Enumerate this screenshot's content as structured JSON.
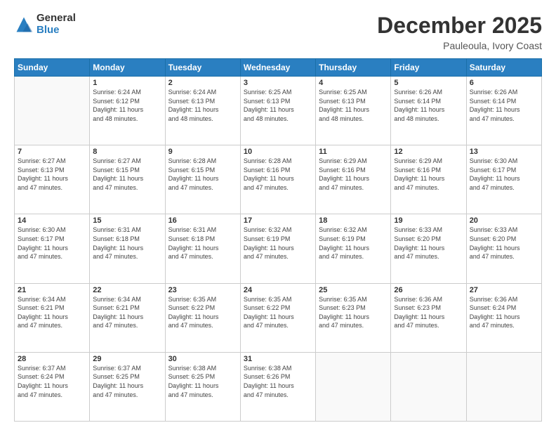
{
  "logo": {
    "general": "General",
    "blue": "Blue"
  },
  "title": "December 2025",
  "subtitle": "Pauleoula, Ivory Coast",
  "header_days": [
    "Sunday",
    "Monday",
    "Tuesday",
    "Wednesday",
    "Thursday",
    "Friday",
    "Saturday"
  ],
  "weeks": [
    [
      {
        "day": "",
        "info": ""
      },
      {
        "day": "1",
        "info": "Sunrise: 6:24 AM\nSunset: 6:12 PM\nDaylight: 11 hours\nand 48 minutes."
      },
      {
        "day": "2",
        "info": "Sunrise: 6:24 AM\nSunset: 6:13 PM\nDaylight: 11 hours\nand 48 minutes."
      },
      {
        "day": "3",
        "info": "Sunrise: 6:25 AM\nSunset: 6:13 PM\nDaylight: 11 hours\nand 48 minutes."
      },
      {
        "day": "4",
        "info": "Sunrise: 6:25 AM\nSunset: 6:13 PM\nDaylight: 11 hours\nand 48 minutes."
      },
      {
        "day": "5",
        "info": "Sunrise: 6:26 AM\nSunset: 6:14 PM\nDaylight: 11 hours\nand 48 minutes."
      },
      {
        "day": "6",
        "info": "Sunrise: 6:26 AM\nSunset: 6:14 PM\nDaylight: 11 hours\nand 47 minutes."
      }
    ],
    [
      {
        "day": "7",
        "info": "Sunrise: 6:27 AM\nSunset: 6:13 PM\nDaylight: 11 hours\nand 47 minutes."
      },
      {
        "day": "8",
        "info": "Sunrise: 6:27 AM\nSunset: 6:15 PM\nDaylight: 11 hours\nand 47 minutes."
      },
      {
        "day": "9",
        "info": "Sunrise: 6:28 AM\nSunset: 6:15 PM\nDaylight: 11 hours\nand 47 minutes."
      },
      {
        "day": "10",
        "info": "Sunrise: 6:28 AM\nSunset: 6:16 PM\nDaylight: 11 hours\nand 47 minutes."
      },
      {
        "day": "11",
        "info": "Sunrise: 6:29 AM\nSunset: 6:16 PM\nDaylight: 11 hours\nand 47 minutes."
      },
      {
        "day": "12",
        "info": "Sunrise: 6:29 AM\nSunset: 6:16 PM\nDaylight: 11 hours\nand 47 minutes."
      },
      {
        "day": "13",
        "info": "Sunrise: 6:30 AM\nSunset: 6:17 PM\nDaylight: 11 hours\nand 47 minutes."
      }
    ],
    [
      {
        "day": "14",
        "info": "Sunrise: 6:30 AM\nSunset: 6:17 PM\nDaylight: 11 hours\nand 47 minutes."
      },
      {
        "day": "15",
        "info": "Sunrise: 6:31 AM\nSunset: 6:18 PM\nDaylight: 11 hours\nand 47 minutes."
      },
      {
        "day": "16",
        "info": "Sunrise: 6:31 AM\nSunset: 6:18 PM\nDaylight: 11 hours\nand 47 minutes."
      },
      {
        "day": "17",
        "info": "Sunrise: 6:32 AM\nSunset: 6:19 PM\nDaylight: 11 hours\nand 47 minutes."
      },
      {
        "day": "18",
        "info": "Sunrise: 6:32 AM\nSunset: 6:19 PM\nDaylight: 11 hours\nand 47 minutes."
      },
      {
        "day": "19",
        "info": "Sunrise: 6:33 AM\nSunset: 6:20 PM\nDaylight: 11 hours\nand 47 minutes."
      },
      {
        "day": "20",
        "info": "Sunrise: 6:33 AM\nSunset: 6:20 PM\nDaylight: 11 hours\nand 47 minutes."
      }
    ],
    [
      {
        "day": "21",
        "info": "Sunrise: 6:34 AM\nSunset: 6:21 PM\nDaylight: 11 hours\nand 47 minutes."
      },
      {
        "day": "22",
        "info": "Sunrise: 6:34 AM\nSunset: 6:21 PM\nDaylight: 11 hours\nand 47 minutes."
      },
      {
        "day": "23",
        "info": "Sunrise: 6:35 AM\nSunset: 6:22 PM\nDaylight: 11 hours\nand 47 minutes."
      },
      {
        "day": "24",
        "info": "Sunrise: 6:35 AM\nSunset: 6:22 PM\nDaylight: 11 hours\nand 47 minutes."
      },
      {
        "day": "25",
        "info": "Sunrise: 6:35 AM\nSunset: 6:23 PM\nDaylight: 11 hours\nand 47 minutes."
      },
      {
        "day": "26",
        "info": "Sunrise: 6:36 AM\nSunset: 6:23 PM\nDaylight: 11 hours\nand 47 minutes."
      },
      {
        "day": "27",
        "info": "Sunrise: 6:36 AM\nSunset: 6:24 PM\nDaylight: 11 hours\nand 47 minutes."
      }
    ],
    [
      {
        "day": "28",
        "info": "Sunrise: 6:37 AM\nSunset: 6:24 PM\nDaylight: 11 hours\nand 47 minutes."
      },
      {
        "day": "29",
        "info": "Sunrise: 6:37 AM\nSunset: 6:25 PM\nDaylight: 11 hours\nand 47 minutes."
      },
      {
        "day": "30",
        "info": "Sunrise: 6:38 AM\nSunset: 6:25 PM\nDaylight: 11 hours\nand 47 minutes."
      },
      {
        "day": "31",
        "info": "Sunrise: 6:38 AM\nSunset: 6:26 PM\nDaylight: 11 hours\nand 47 minutes."
      },
      {
        "day": "",
        "info": ""
      },
      {
        "day": "",
        "info": ""
      },
      {
        "day": "",
        "info": ""
      }
    ]
  ]
}
